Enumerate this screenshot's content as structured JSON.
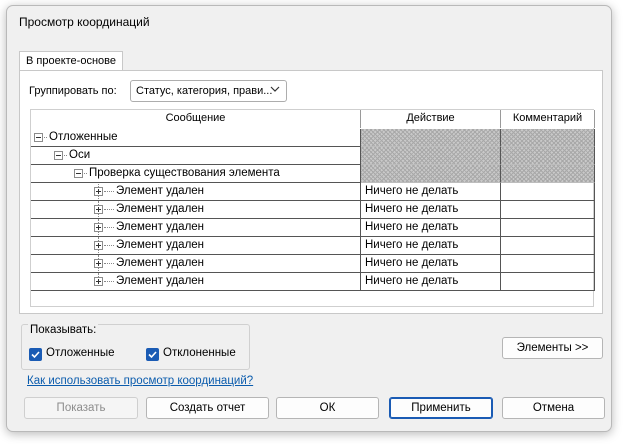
{
  "window": {
    "title": "Просмотр координаций"
  },
  "tab": {
    "label": "В проекте-основе"
  },
  "group_by": {
    "label": "Группировать по:",
    "value": "Статус, категория, прави..."
  },
  "grid": {
    "columns": [
      "Сообщение",
      "Действие",
      "Комментарий"
    ],
    "rows": [
      {
        "level": 0,
        "text": "Отложенные",
        "action": "",
        "comment": "",
        "hatched": true
      },
      {
        "level": 1,
        "text": "Оси",
        "action": "",
        "comment": "",
        "hatched": true
      },
      {
        "level": 2,
        "text": "Проверка существования элемента",
        "action": "",
        "comment": "",
        "hatched": true
      },
      {
        "level": 3,
        "text": "Элемент удален",
        "action": "Ничего не делать",
        "comment": ""
      },
      {
        "level": 3,
        "text": "Элемент удален",
        "action": "Ничего не делать",
        "comment": ""
      },
      {
        "level": 3,
        "text": "Элемент удален",
        "action": "Ничего не делать",
        "comment": ""
      },
      {
        "level": 3,
        "text": "Элемент удален",
        "action": "Ничего не делать",
        "comment": ""
      },
      {
        "level": 3,
        "text": "Элемент удален",
        "action": "Ничего не делать",
        "comment": ""
      },
      {
        "level": 3,
        "text": "Элемент удален",
        "action": "Ничего не делать",
        "comment": ""
      }
    ]
  },
  "show": {
    "legend": "Показывать:",
    "postponed": {
      "label": "Отложенные",
      "checked": true
    },
    "rejected": {
      "label": "Отклоненные",
      "checked": true
    }
  },
  "buttons": {
    "elements": "Элементы >>",
    "show": "Показать",
    "report": "Создать отчет",
    "ok": "ОК",
    "apply": "Применить",
    "cancel": "Отмена"
  },
  "help_link": "Как использовать просмотр координаций?",
  "colors": {
    "accent": "#1a5bb4",
    "link": "#0b5cad"
  }
}
